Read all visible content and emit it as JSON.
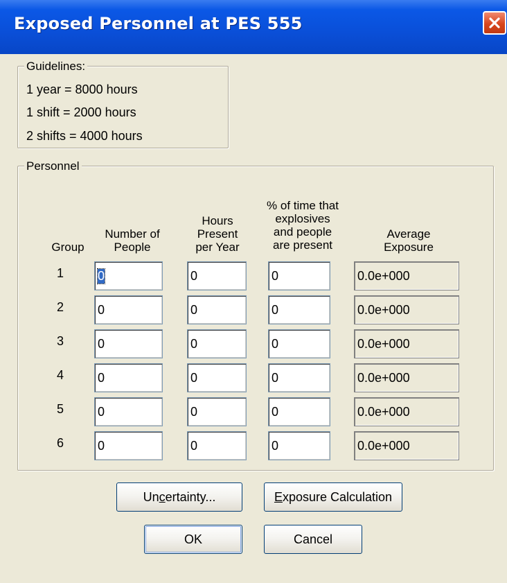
{
  "window": {
    "title": "Exposed Personnel at PES 555",
    "close_glyph": "close-icon"
  },
  "guidelines": {
    "legend": "Guidelines:",
    "lines": [
      "1 year = 8000 hours",
      "1 shift = 2000 hours",
      "2 shifts = 4000 hours"
    ]
  },
  "personnel": {
    "legend": "Personnel",
    "headers": {
      "group": "Group",
      "people": [
        "Number of",
        "People"
      ],
      "hours": [
        "Hours",
        "Present",
        "per Year"
      ],
      "percent": [
        "% of time that",
        "explosives",
        "and people",
        "are present"
      ],
      "exposure": [
        "Average",
        "Exposure"
      ]
    },
    "rows": [
      {
        "group": "1",
        "people": "0",
        "hours": "0",
        "percent": "0",
        "exposure": "0.0e+000"
      },
      {
        "group": "2",
        "people": "0",
        "hours": "0",
        "percent": "0",
        "exposure": "0.0e+000"
      },
      {
        "group": "3",
        "people": "0",
        "hours": "0",
        "percent": "0",
        "exposure": "0.0e+000"
      },
      {
        "group": "4",
        "people": "0",
        "hours": "0",
        "percent": "0",
        "exposure": "0.0e+000"
      },
      {
        "group": "5",
        "people": "0",
        "hours": "0",
        "percent": "0",
        "exposure": "0.0e+000"
      },
      {
        "group": "6",
        "people": "0",
        "hours": "0",
        "percent": "0",
        "exposure": "0.0e+000"
      }
    ]
  },
  "buttons": {
    "uncertainty": {
      "pre": "Un",
      "acc": "c",
      "post": "ertainty..."
    },
    "exposure_calc": {
      "pre": "",
      "acc": "E",
      "post": "xposure Calculation"
    },
    "ok": "OK",
    "cancel": "Cancel"
  },
  "colors": {
    "titlebar": "#0a4fd8",
    "dialog_bg": "#ece9d8",
    "selection": "#316ac5"
  }
}
